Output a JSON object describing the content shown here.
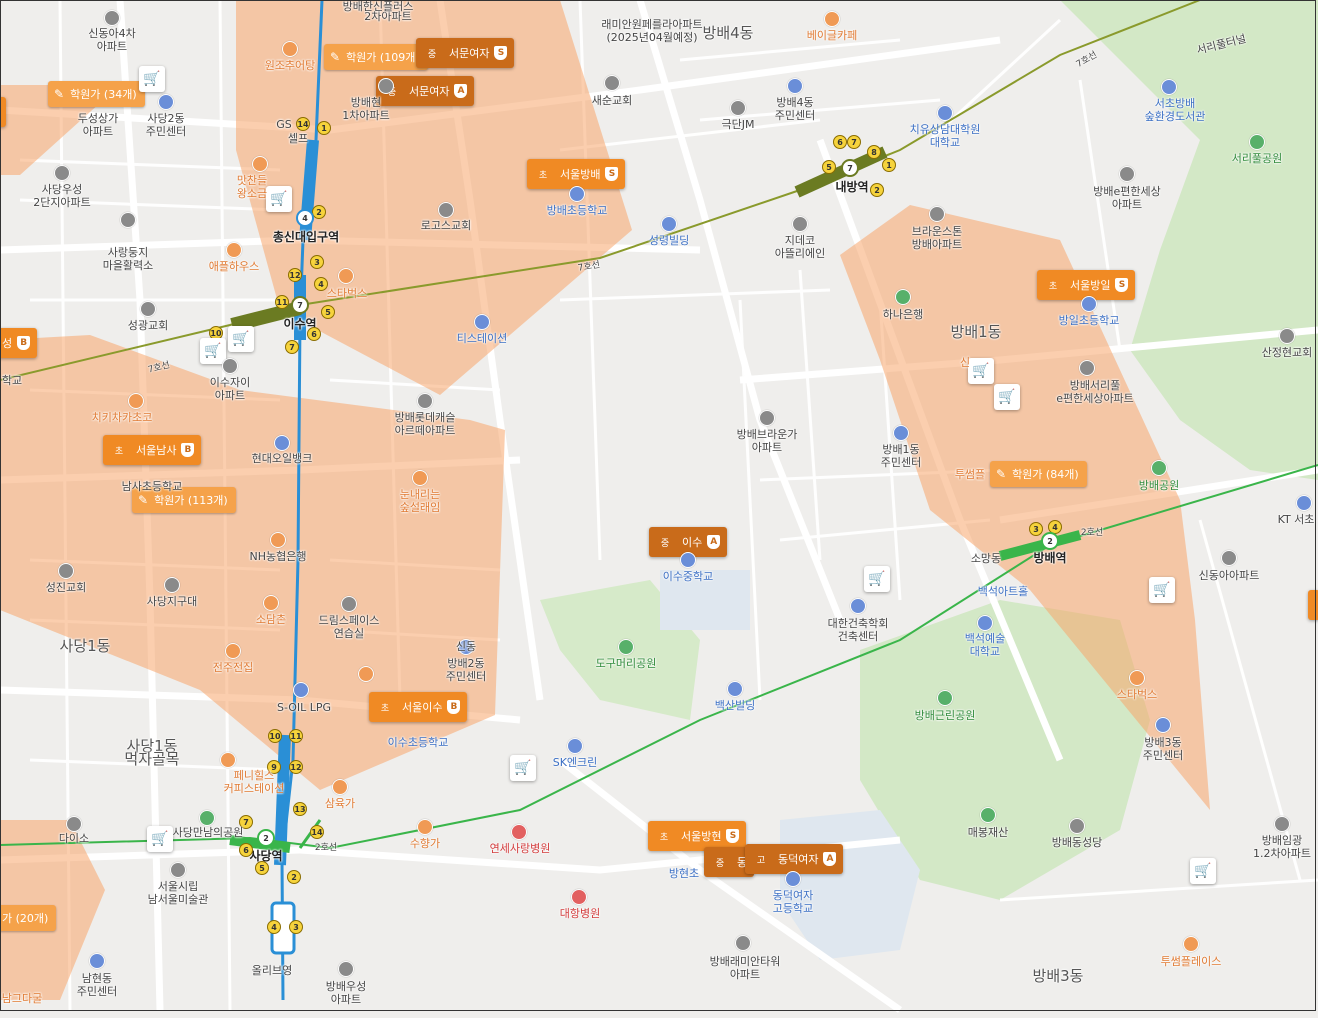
{
  "map": {
    "areas": {
      "sadang_1dong": "사당1동",
      "sadang_1dong_food": "사당1동\n먹자골목",
      "bangbae_4dong": "방배4동",
      "bangbae_1dong": "방배1동",
      "bangbae_2dong": "방배2동",
      "bangbae_3dong": "방배3동"
    },
    "stations": {
      "chongshin": "총신대입구역",
      "isu": "이수역",
      "naebang": "내방역",
      "bangbae": "방배역",
      "sadang": "사당역"
    },
    "line_labels": {
      "line7_a": "7호선",
      "line7_b": "7호선",
      "line7_c": "7호선",
      "line2_a": "2호선",
      "line2_b": "2호선",
      "seoripul": "서리풀터널"
    },
    "school_chips": [
      {
        "name": "서문여자",
        "badge": "S",
        "icon": "중"
      },
      {
        "name": "서문여자",
        "badge": "A",
        "icon": "중"
      },
      {
        "name": "서울방배",
        "badge": "S",
        "icon": "초"
      },
      {
        "name": "서울방일",
        "badge": "S",
        "icon": "초"
      },
      {
        "name": "서울남사",
        "badge": "B",
        "icon": "초"
      },
      {
        "name": "이수",
        "badge": "A",
        "icon": "중"
      },
      {
        "name": "서울이수",
        "badge": "B",
        "icon": "초"
      },
      {
        "name": "서울방현",
        "badge": "S",
        "icon": "초"
      },
      {
        "name": "동",
        "badge": "",
        "icon": "중"
      },
      {
        "name": "동덕여자",
        "badge": "A",
        "icon": "고"
      },
      {
        "name": "성",
        "badge": "B",
        "icon": ""
      }
    ],
    "academy_chips": [
      {
        "label": "학원가 (34개)"
      },
      {
        "label": "학원가 (109개)"
      },
      {
        "label": "학원가 (113개)"
      },
      {
        "label": "학원가 (84개)"
      },
      {
        "label": "가 (20개)"
      }
    ],
    "places": [
      {
        "text": "신동아4차\n아파트"
      },
      {
        "text": "두성상가\n아파트"
      },
      {
        "text": "사당2동\n주민센터"
      },
      {
        "text": "사당우성\n2단지아파트"
      },
      {
        "text": "사랑둥지\n마을활력소"
      },
      {
        "text": "성광교회"
      },
      {
        "text": "원조추어탕"
      },
      {
        "text": "방배현\n1차아파트"
      },
      {
        "text": "GS"
      },
      {
        "text": "셀프"
      },
      {
        "text": "맛찬들\n왕소금"
      },
      {
        "text": "애플하우스"
      },
      {
        "text": "스타벅스"
      },
      {
        "text": "이수자이\n아파트"
      },
      {
        "text": "치키차카초코"
      },
      {
        "text": "현대오일뱅크"
      },
      {
        "text": "방배롯데캐슬\n아르떼아파트"
      },
      {
        "text": "눈내리는\n숲설래임"
      },
      {
        "text": "NH농협은행"
      },
      {
        "text": "성진교회"
      },
      {
        "text": "사당지구대"
      },
      {
        "text": "소담촌"
      },
      {
        "text": "드림스페이스\n연습실"
      },
      {
        "text": "전주전집"
      },
      {
        "text": "방배2동\n주민센터"
      },
      {
        "text": "S-OIL LPG"
      },
      {
        "text": "이수초등학교"
      },
      {
        "text": "페니힐스\n커피스테이션"
      },
      {
        "text": "삼육가"
      },
      {
        "text": "다이소"
      },
      {
        "text": "사당만남의공원"
      },
      {
        "text": "서울시립\n남서울미술관"
      },
      {
        "text": "올리브영"
      },
      {
        "text": "남현동\n주민센터"
      },
      {
        "text": "방배우성\n아파트"
      },
      {
        "text": "수향가"
      },
      {
        "text": "연세사랑병원"
      },
      {
        "text": "대항병원"
      },
      {
        "text": "방배래미안타워\n아파트"
      },
      {
        "text": "방현초"
      },
      {
        "text": "동덕여자\n고등학교"
      },
      {
        "text": "SK엔크린"
      },
      {
        "text": "백산빌딩"
      },
      {
        "text": "도구머리공원"
      },
      {
        "text": "이수중학교"
      },
      {
        "text": "티스테이션"
      },
      {
        "text": "로고스교회"
      },
      {
        "text": "방배초등학교"
      },
      {
        "text": "성령빌딩"
      },
      {
        "text": "새순교회"
      },
      {
        "text": "래미안원페를라아파트\n(2025년04월예정)"
      },
      {
        "text": "극단JM"
      },
      {
        "text": "방배4동\n주민센터"
      },
      {
        "text": "베이글카페"
      },
      {
        "text": "치유상담대학원\n대학교"
      },
      {
        "text": "서초방배\n숲환경도서관"
      },
      {
        "text": "서리풀공원"
      },
      {
        "text": "방배e편한세상\n아파트"
      },
      {
        "text": "지데코\n아뜰리에인"
      },
      {
        "text": "브라운스톤\n방배아파트"
      },
      {
        "text": "하나은행"
      },
      {
        "text": "방일초등학교"
      },
      {
        "text": "산정현교회"
      },
      {
        "text": "방배서리풀\ne편한세상아파트"
      },
      {
        "text": "방배브라운가\n아파트"
      },
      {
        "text": "방배1동\n주민센터"
      },
      {
        "text": "투썸플"
      },
      {
        "text": "방배공원"
      },
      {
        "text": "KT 서초"
      },
      {
        "text": "신동아아파트"
      },
      {
        "text": "소망동"
      },
      {
        "text": "백석아트홀"
      },
      {
        "text": "백석예술\n대학교"
      },
      {
        "text": "대한건축학회\n건축센터"
      },
      {
        "text": "방배근린공원"
      },
      {
        "text": "스타벅스"
      },
      {
        "text": "방배3동\n주민센터"
      },
      {
        "text": "매봉재산"
      },
      {
        "text": "방배동성당"
      },
      {
        "text": "방배임광\n1.2차아파트"
      },
      {
        "text": "투썸플레이스"
      },
      {
        "text": "신동"
      },
      {
        "text": "학교"
      },
      {
        "text": "남사초등학교"
      },
      {
        "text": "신"
      },
      {
        "text": "2차아파트"
      },
      {
        "text": "방배한신플러스"
      },
      {
        "text": "남그다굴"
      }
    ],
    "colors": {
      "academy_zone": "#f7a66b",
      "school_chip": "#f08a24",
      "line2": "#3ab54a",
      "line4": "#2a8fd6",
      "line7": "#6b7b22",
      "park": "#cfe6c2"
    }
  }
}
